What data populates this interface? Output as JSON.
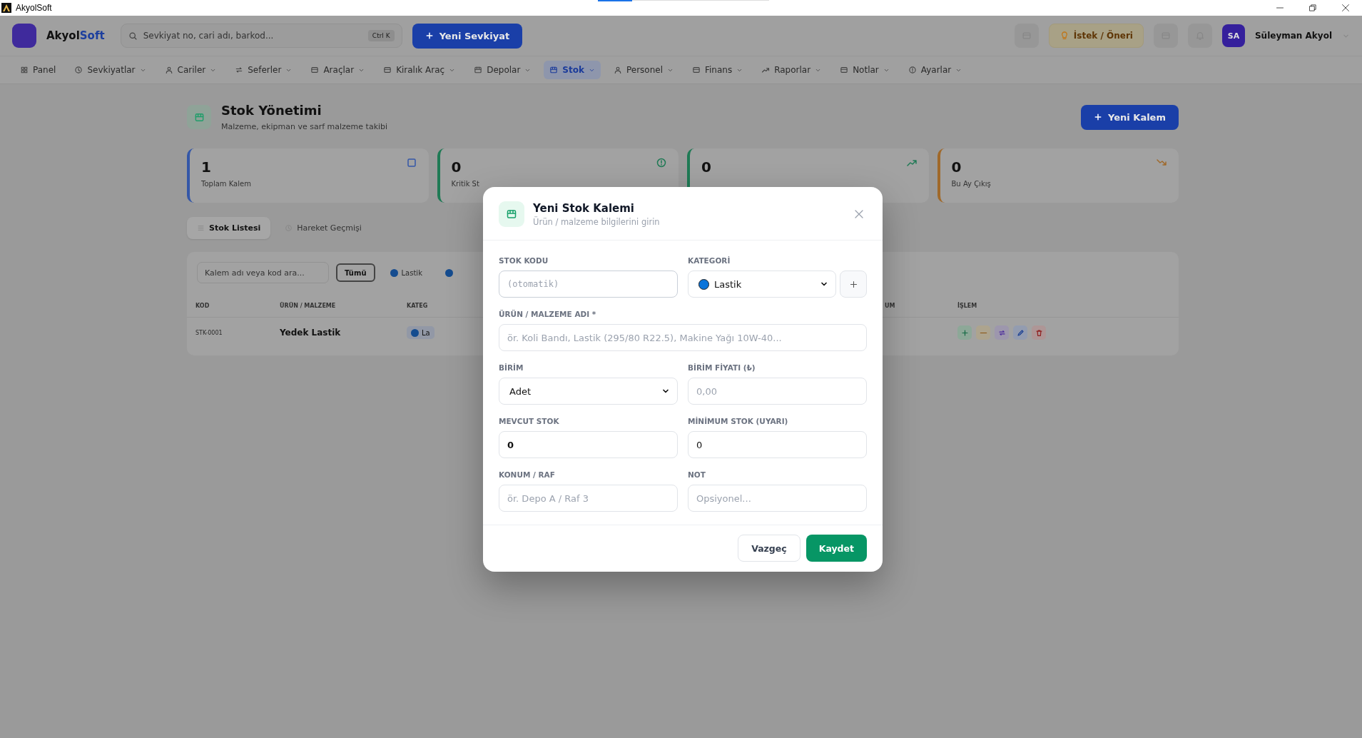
{
  "window": {
    "title": "AkyolSoft"
  },
  "header": {
    "brand": {
      "name": "Akyol",
      "accent": "Soft"
    },
    "search": {
      "placeholder": "Sevkiyat no, cari adı, barkod...",
      "shortcut": "Ctrl K"
    },
    "primary_button": "Yeni Sevkiyat",
    "suggestion_button": "İstek / Öneri",
    "user": {
      "initials": "SA",
      "name": "Süleyman Akyol"
    }
  },
  "nav": [
    {
      "label": "Panel",
      "selected": false,
      "dropdown": false
    },
    {
      "label": "Sevkiyatlar",
      "selected": false,
      "dropdown": true
    },
    {
      "label": "Cariler",
      "selected": false,
      "dropdown": true
    },
    {
      "label": "Seferler",
      "selected": false,
      "dropdown": true
    },
    {
      "label": "Araçlar",
      "selected": false,
      "dropdown": true
    },
    {
      "label": "Kiralık Araç",
      "selected": false,
      "dropdown": true
    },
    {
      "label": "Depolar",
      "selected": false,
      "dropdown": true
    },
    {
      "label": "Stok",
      "selected": true,
      "dropdown": true
    },
    {
      "label": "Personel",
      "selected": false,
      "dropdown": true
    },
    {
      "label": "Finans",
      "selected": false,
      "dropdown": true
    },
    {
      "label": "Raporlar",
      "selected": false,
      "dropdown": true
    },
    {
      "label": "Notlar",
      "selected": false,
      "dropdown": true
    },
    {
      "label": "Ayarlar",
      "selected": false,
      "dropdown": true
    }
  ],
  "page": {
    "title": "Stok Yönetimi",
    "subtitle": "Malzeme, ekipman ve sarf malzeme takibi",
    "add_button": "Yeni Kalem"
  },
  "stat_cards": [
    {
      "value": "1",
      "label": "Toplam Kalem",
      "color": "#3457a8",
      "kind": "box"
    },
    {
      "value": "0",
      "label": "Kritik St",
      "color": "#1f7a55",
      "kind": "alert"
    },
    {
      "value": "0",
      "color": "#1f7a55",
      "kind": "up"
    },
    {
      "value": "0",
      "label": "Bu Ay Çıkış",
      "color": "#a0692a",
      "kind": "down"
    }
  ],
  "tabs": [
    {
      "label": "Stok Listesi",
      "selected": true
    },
    {
      "label": "Hareket Geçmişi",
      "selected": false
    }
  ],
  "filters": {
    "search_placeholder": "Kalem adı veya kod ara...",
    "chips": [
      {
        "label": "Tümü",
        "selected": true
      },
      {
        "label": "Lastik",
        "selected": false,
        "color": "#154c8f"
      },
      {
        "selected": false,
        "color": "#154c8f"
      }
    ]
  },
  "table": {
    "columns": [
      "KOD",
      "ÜRÜN / MALZEME",
      "KATEG",
      "UM",
      "İŞLEM"
    ],
    "rows": [
      {
        "code": "STK-0001",
        "name": "Yedek Lastik",
        "category": {
          "label": "La",
          "color": "#154c8f"
        },
        "actions": [
          {
            "kind": "in"
          },
          {
            "kind": "out"
          },
          {
            "kind": "move"
          },
          {
            "kind": "edit"
          },
          {
            "kind": "delete"
          }
        ]
      }
    ]
  },
  "dialog": {
    "title": "Yeni Stok Kalemi",
    "subtitle": "Ürün / malzeme bilgilerini girin",
    "fields": [
      {
        "label": "STOK KODU",
        "kind": "text",
        "placeholder": "(otomatik)",
        "mono": true,
        "focused": true
      },
      {
        "label": "KATEGORİ",
        "kind": "category",
        "value": "Lastik",
        "color": "#0a74da"
      },
      {
        "label": "ÜRÜN / MALZEME ADI *",
        "kind": "text",
        "placeholder": "ör. Koli Bandı, Lastik (295/80 R22.5), Makine Yağı 10W-40...",
        "wide": true
      },
      {
        "label": "BİRİM",
        "kind": "select",
        "value": "Adet"
      },
      {
        "label": "BİRİM FİYATI (₺)",
        "kind": "text",
        "placeholder": "0,00"
      },
      {
        "label": "MEVCUT STOK",
        "kind": "text",
        "value": "0",
        "strong": true
      },
      {
        "label": "MİNİMUM STOK (UYARI)",
        "kind": "text",
        "value": "0"
      },
      {
        "label": "KONUM / RAF",
        "kind": "text",
        "placeholder": "ör. Depo A / Raf 3"
      },
      {
        "label": "NOT",
        "kind": "text",
        "placeholder": "Opsiyonel..."
      }
    ],
    "cancel_button": "Vazgeç",
    "save_button": "Kaydet"
  }
}
